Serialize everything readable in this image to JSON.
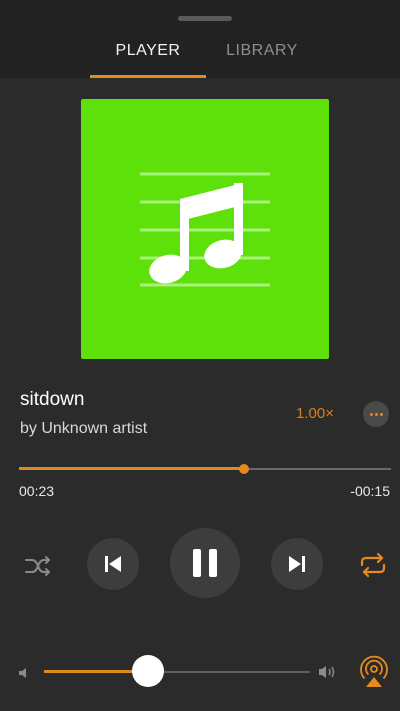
{
  "tabs": [
    {
      "label": "PLAYER",
      "active": true
    },
    {
      "label": "LIBRARY",
      "active": false
    }
  ],
  "artwork": {
    "background": "#5ee10a",
    "icon": "music-note-icon"
  },
  "track": {
    "title": "sitdown",
    "artist": "by Unknown artist"
  },
  "playback": {
    "speed": "1.00×",
    "elapsed": "00:23",
    "remaining": "-00:15",
    "progress_fraction": 0.605
  },
  "controls": {
    "shuffle": "shuffle-icon",
    "previous": "skip-previous-icon",
    "play_pause": "pause-icon",
    "next": "skip-next-icon",
    "repeat": "repeat-icon",
    "more": "more-icon"
  },
  "volume": {
    "level_fraction": 0.39,
    "airplay": "airplay-icon"
  },
  "colors": {
    "accent": "#e58a1f",
    "background": "#2b2b2b",
    "header": "#222222"
  }
}
